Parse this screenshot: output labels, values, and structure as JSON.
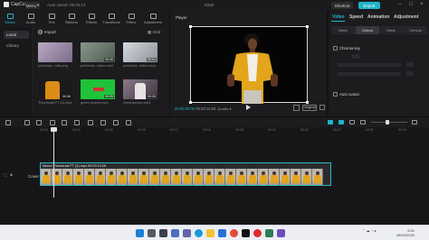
{
  "titlebar": {
    "app_name": "CapCut",
    "menu_label": "Menu",
    "autosave_text": "Auto saved: 09:25:12",
    "doc_title": "0318",
    "shortcut_label": "Shortcut",
    "export_label": "Export"
  },
  "toolbar": {
    "tools": [
      {
        "label": "Media",
        "icon": "media-icon"
      },
      {
        "label": "Audio",
        "icon": "audio-icon"
      },
      {
        "label": "Text",
        "icon": "text-icon"
      },
      {
        "label": "Stickers",
        "icon": "stickers-icon"
      },
      {
        "label": "Effects",
        "icon": "effects-icon"
      },
      {
        "label": "Transitions",
        "icon": "transitions-icon"
      },
      {
        "label": "Filters",
        "icon": "filters-icon"
      },
      {
        "label": "Adjustment",
        "icon": "adjustment-icon"
      }
    ]
  },
  "media": {
    "nav": [
      "Local",
      "Library"
    ],
    "import_label": "Import",
    "view_label": "Grid",
    "items": [
      {
        "caption": "performa...ucts.png",
        "duration": "",
        "color": "#8e7d96"
      },
      {
        "caption": "performa...video.mp4",
        "duration": "00:06",
        "color": "#6d7a6e"
      },
      {
        "caption": "performa...video.mp4",
        "duration": "00:04",
        "color": "#9aa0a8"
      },
      {
        "caption": "Thumbnail FT (2).mp4",
        "duration": "00:06",
        "color": "#c47a1c"
      },
      {
        "caption": "green screen.mp4",
        "duration": "00:05",
        "color": "#1fc33a"
      },
      {
        "caption": "Greenscreen.mp4",
        "duration": "00:09",
        "color": "#6a5a66"
      }
    ]
  },
  "player": {
    "title": "Player",
    "current_time": "00:00:00:00",
    "total_time": "00:00:14:26",
    "quality_label": "Quality",
    "ratio_label": "Original"
  },
  "inspector": {
    "tabs": [
      "Video",
      "Speed",
      "Animation",
      "Adjustment"
    ],
    "subtabs": [
      "Basic",
      "Cutout",
      "Mask",
      "Canvas"
    ],
    "chroma_key_label": "Chroma key",
    "auto_cutout_label": "Auto cutout"
  },
  "timeline": {
    "ticks": [
      "00:00",
      "00:03",
      "00:06",
      "00:09",
      "00:12",
      "00:15",
      "00:18",
      "00:21",
      "00:24",
      "00:27",
      "00:30",
      "00:33",
      "00:36"
    ],
    "cover_label": "Cover",
    "clip_label": "Muted  Thumbnail FT (2).mp4  00:00:14:26",
    "frame_count": 26
  },
  "taskbar": {
    "time": "9:21",
    "date": "28/10/2022",
    "icons": [
      {
        "name": "windows-start-icon",
        "color": "#1e7fd8"
      },
      {
        "name": "taskbar-search-icon",
        "color": "#555b66"
      },
      {
        "name": "task-view-icon",
        "color": "#3b3f46"
      },
      {
        "name": "widgets-icon",
        "color": "#4a6fc1"
      },
      {
        "name": "teams-chat-icon",
        "color": "#6264a7"
      },
      {
        "name": "edge-icon",
        "color": "#1a9bd7"
      },
      {
        "name": "file-explorer-icon",
        "color": "#f2c230"
      },
      {
        "name": "store-icon",
        "color": "#2a6fd6"
      },
      {
        "name": "chrome-icon",
        "color": "#e24b3b"
      },
      {
        "name": "capcut-icon",
        "color": "#111111"
      },
      {
        "name": "record-icon",
        "color": "#d92d2d"
      },
      {
        "name": "app-icon",
        "color": "#2e7d5a"
      },
      {
        "name": "app-icon-2",
        "color": "#6b4fbf"
      }
    ]
  },
  "colors": {
    "accent": "#1fb5c9",
    "panel": "#1c1c1f",
    "green_screen": "#1fc33a"
  }
}
